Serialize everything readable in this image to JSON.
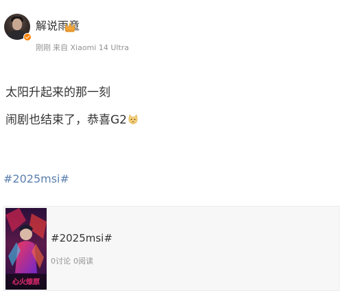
{
  "author": {
    "name": "解说雨童",
    "crown_icon": "crown-badge-icon",
    "verified_icon": "verified-badge-icon",
    "verified_color": "#ff8200",
    "time": "刚刚",
    "source": "来自 Xiaomi 14 Ultra"
  },
  "post": {
    "line1": "太阳升起来的那一刻",
    "line2": "闹剧也结束了，恭喜G2",
    "line2_emoji": "cat-emoji-icon",
    "hashtag": "#2025msi#",
    "hashtag_color": "#5a7fae"
  },
  "topic_card": {
    "title": "#2025msi#",
    "discussions": "0讨论",
    "reads": "0阅读",
    "cover_text": "心火燎原"
  }
}
